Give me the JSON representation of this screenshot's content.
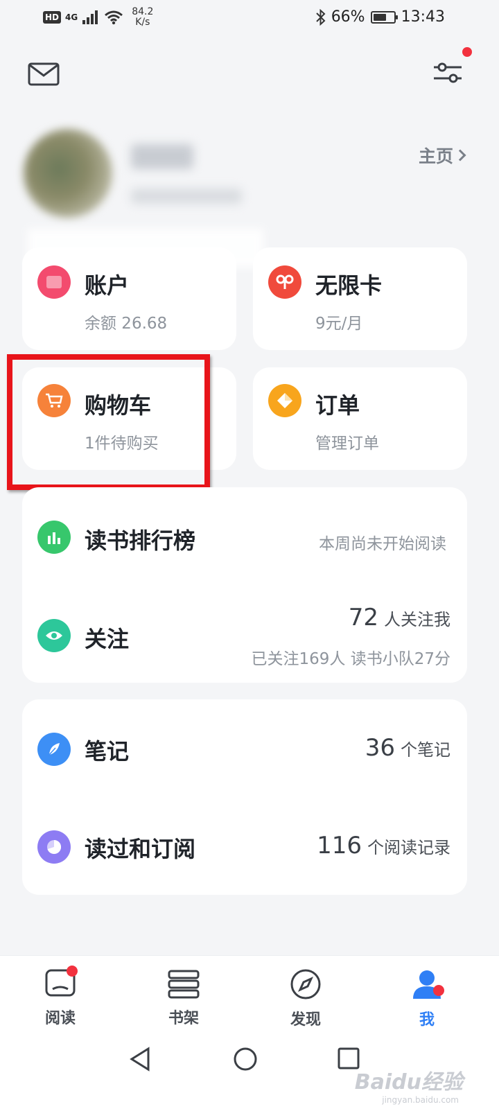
{
  "status_bar": {
    "hd": "HD",
    "network": "4G",
    "speed_value": "84.2",
    "speed_unit": "K/s",
    "battery_percent": "66%",
    "battery_level": 0.66,
    "time": "13:43"
  },
  "header": {
    "homepage_label": "主页"
  },
  "grid": {
    "account": {
      "title": "账户",
      "subtitle": "余额 26.68",
      "icon": "wallet-icon",
      "color": "#f34b6e"
    },
    "unlimited": {
      "title": "无限卡",
      "subtitle": "9元/月",
      "icon": "unlimited-card-icon",
      "color": "#f04a3c"
    },
    "cart": {
      "title": "购物车",
      "subtitle": "1件待购买",
      "icon": "shopping-cart-icon",
      "color": "#f6823a"
    },
    "orders": {
      "title": "订单",
      "subtitle": "管理订单",
      "icon": "order-icon",
      "color": "#f8a51d"
    }
  },
  "social": {
    "ranking": {
      "title": "读书排行榜",
      "status": "本周尚未开始阅读",
      "icon": "bar-chart-icon",
      "color": "#37c76c"
    },
    "follow": {
      "title": "关注",
      "followers_count": "72",
      "followers_label": "人关注我",
      "detail": "已关注169人 读书小队27分",
      "icon": "eye-icon",
      "color": "#2dc79a"
    }
  },
  "library": {
    "notes": {
      "title": "笔记",
      "count": "36",
      "count_label": "个笔记",
      "icon": "feather-icon",
      "color": "#3d8ff5"
    },
    "history": {
      "title": "读过和订阅",
      "count": "116",
      "count_label": "个阅读记录",
      "icon": "pie-icon",
      "color": "#8d7cf3"
    }
  },
  "tabs": [
    {
      "label": "阅读",
      "icon": "reading-icon"
    },
    {
      "label": "书架",
      "icon": "bookshelf-icon"
    },
    {
      "label": "发现",
      "icon": "compass-icon"
    },
    {
      "label": "我",
      "icon": "person-icon"
    }
  ],
  "watermark": {
    "main": "Baidu经验",
    "sub": "jingyan.baidu.com"
  }
}
